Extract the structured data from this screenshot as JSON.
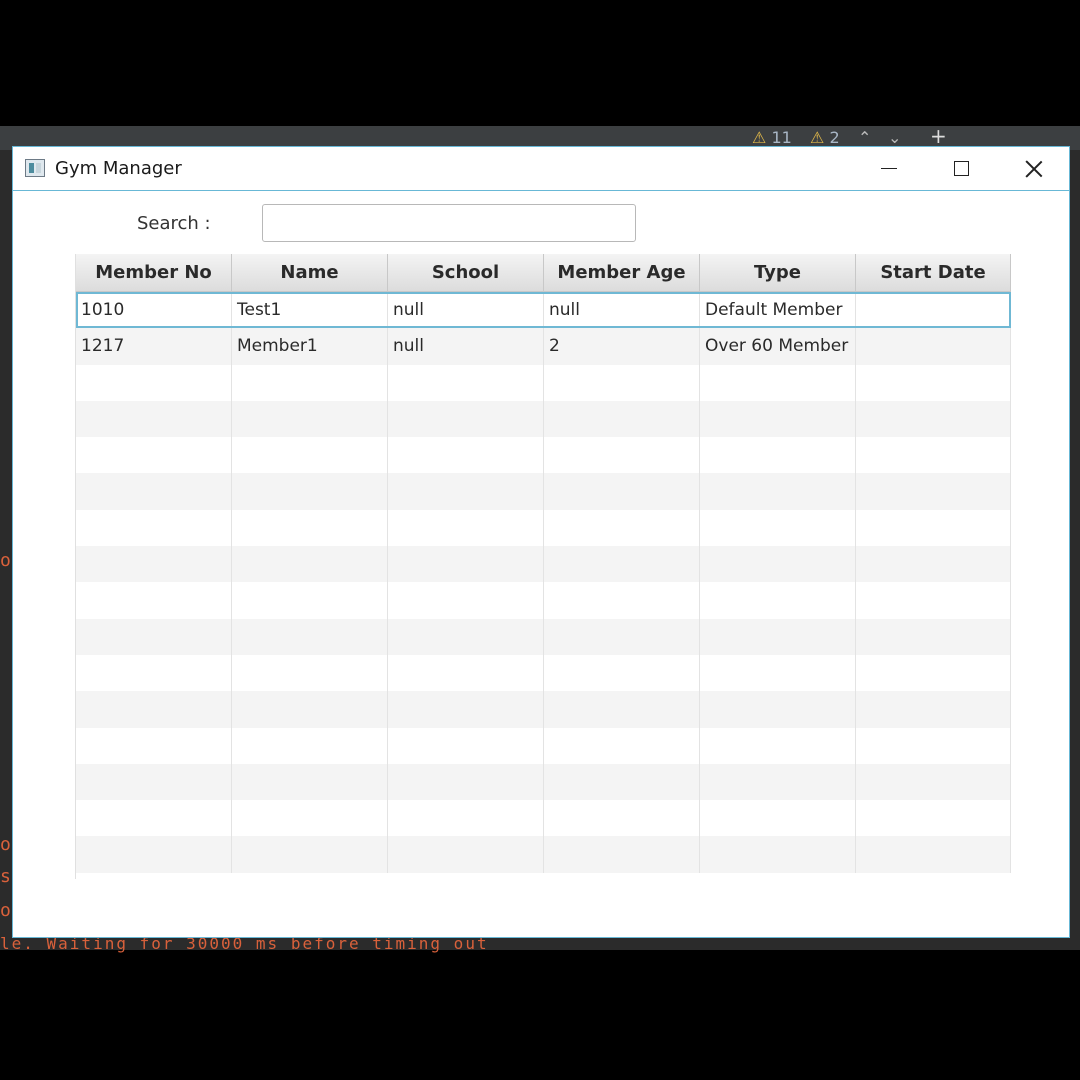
{
  "window": {
    "title": "Gym Manager"
  },
  "background": {
    "warnings": "11",
    "weak_warnings": "2",
    "console_line": "le. Waiting for 30000 ms before timing out"
  },
  "search": {
    "label": "Search :",
    "value": "",
    "placeholder": ""
  },
  "table": {
    "columns": [
      "Member No",
      "Name",
      "School",
      "Member Age",
      "Type",
      "Start Date"
    ],
    "rows": [
      [
        "1010",
        "Test1",
        "null",
        "null",
        "Default Member",
        ""
      ],
      [
        "1217",
        "Member1",
        "null",
        "2",
        "Over 60 Member",
        ""
      ]
    ],
    "selected_row": 0
  }
}
